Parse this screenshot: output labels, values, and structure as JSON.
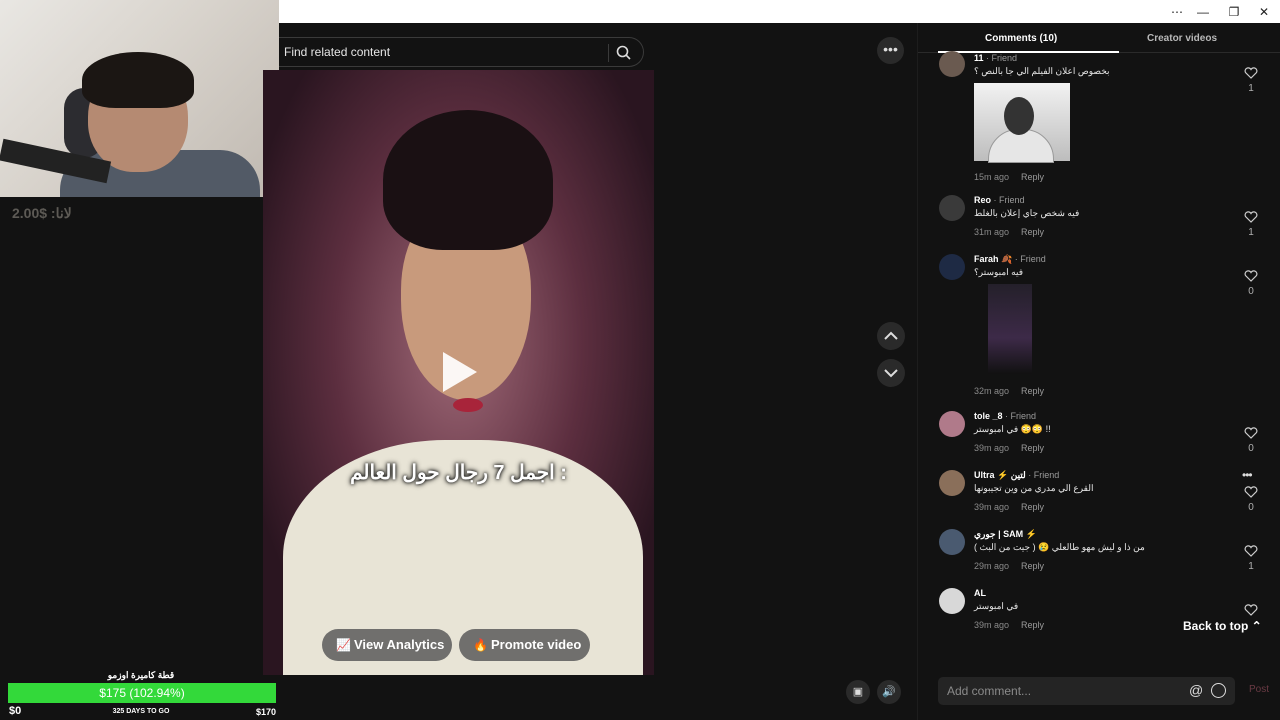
{
  "window": {
    "controls": [
      "⋯",
      "—",
      "❐",
      "✕"
    ]
  },
  "stream_overlay": {
    "top_label": "لانا: $2.00",
    "goal": {
      "title": "قطة كاميرة اوزمو",
      "amount": "$175 (102.94%)",
      "progress": 1.0,
      "start": "$0",
      "days": "325 DAYS TO GO",
      "target": "$170",
      "bar_color": "#33d93a"
    }
  },
  "search": {
    "placeholder": "Find related content"
  },
  "video": {
    "caption": "اجمل 7 رجال حول العالم :",
    "view_analytics": "View Analytics",
    "promote_video": "Promote video"
  },
  "comments_panel": {
    "tab_comments": "Comments (10)",
    "tab_creator_videos": "Creator videos",
    "items": [
      {
        "name": "11",
        "tag": "· Friend",
        "text": "بخصوص اعلان الفيلم الي جا بالنص ؟",
        "time": "15m ago",
        "reply": "Reply",
        "likes": "1",
        "avatar_color": "#6a5a50"
      },
      {
        "name": "Reo",
        "tag": "· Friend",
        "text": "فيه شخص جاي إعلان بالغلط",
        "time": "31m ago",
        "reply": "Reply",
        "likes": "1",
        "avatar_color": "#3a3a3a"
      },
      {
        "name": "Farah 🍂",
        "tag": "· Friend",
        "text": "فيه امبوستر؟",
        "time": "32m ago",
        "reply": "Reply",
        "likes": "0",
        "avatar_color": "#1e2a44"
      },
      {
        "name": "tole _8",
        "tag": "· Friend",
        "text": "في امبوستر 😳😳 !!",
        "time": "39m ago",
        "reply": "Reply",
        "likes": "0",
        "avatar_color": "#b07a8a"
      },
      {
        "name": "Ultra ⚡ لتين",
        "tag": "· Friend",
        "text": "القرع الي مدري من وين تجيبونها",
        "time": "39m ago",
        "reply": "Reply",
        "likes": "0",
        "avatar_color": "#8a6f5a"
      },
      {
        "name": "جوري | SAM ⚡",
        "tag": "",
        "text": "من ذا و ليش مهو طالعلي 😢 ( جيت من البث )",
        "time": "29m ago",
        "reply": "Reply",
        "likes": "1",
        "avatar_color": "#4a5a70"
      },
      {
        "name": "AL",
        "tag": "",
        "text": "في امبوستر",
        "time": "39m ago",
        "reply": "Reply",
        "likes": "",
        "avatar_color": "#d8d8d8"
      }
    ],
    "back_to_top": "Back to top ⌃",
    "add_comment_placeholder": "Add comment...",
    "post": "Post",
    "at_symbol": "@"
  }
}
